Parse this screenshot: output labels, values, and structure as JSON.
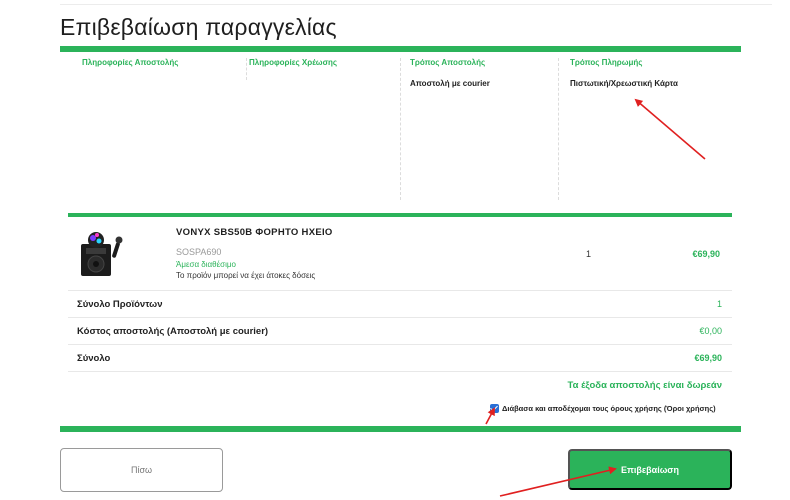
{
  "page_title": "Επιβεβαίωση παραγγελίας",
  "info": {
    "shipping_info_label": "Πληροφορίες Αποστολής",
    "billing_info_label": "Πληροφορίες Χρέωσης",
    "shipping_method_label": "Τρόπος Αποστολής",
    "shipping_method_value": "Αποστολή με courier",
    "payment_method_label": "Τρόπος Πληρωμής",
    "payment_method_value": "Πιστωτική/Χρεωστική Κάρτα"
  },
  "product": {
    "name": "VONYX SBS50B ΦΟΡΗΤΟ ΗΧΕΙΟ",
    "code": "SOSPA690",
    "stock": "Άμεσα διαθέσιμο",
    "note": "Το προϊόν μπορεί να έχει άτοκες δόσεις",
    "quantity": "1",
    "price": "€69,90"
  },
  "summary": {
    "products_total_label": "Σύνολο Προϊόντων",
    "products_total_value": "1",
    "shipping_cost_label": "Κόστος αποστολής (Αποστολή με courier)",
    "shipping_cost_value": "€0,00",
    "total_label": "Σύνολο",
    "total_value": "€69,90",
    "free_shipping": "Τα έξοδα αποστολής είναι δωρεάν"
  },
  "terms": {
    "checked": true,
    "label": "Διάβασα και αποδέχομαι τους όρους χρήσης (Όροι χρήσης)"
  },
  "buttons": {
    "back": "Πίσω",
    "confirm": "Επιβεβαίωση"
  },
  "colors": {
    "accent": "#2bb35a",
    "annotation": "#e02020",
    "checkbox": "#2a6fd6"
  },
  "icons": {
    "product_image": "karaoke-speaker-icon",
    "annotation": "arrow-icon"
  }
}
